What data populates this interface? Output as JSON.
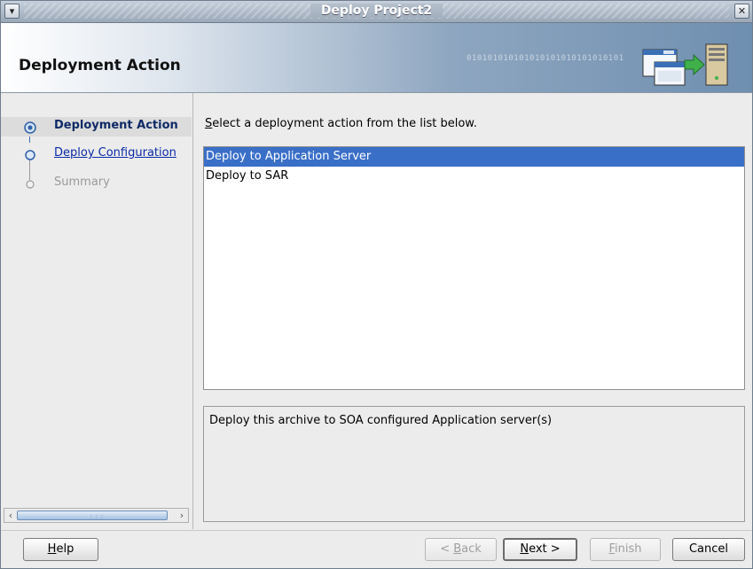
{
  "window": {
    "title": "Deploy Project2"
  },
  "banner": {
    "heading": "Deployment Action",
    "decor_text": "010101010101010101010101010101"
  },
  "nav": {
    "items": [
      {
        "label": "Deployment Action",
        "state": "active"
      },
      {
        "label": "Deploy Configuration",
        "state": "link"
      },
      {
        "label": "Summary",
        "state": "disabled"
      }
    ]
  },
  "main": {
    "instruction_prefix": "S",
    "instruction_rest": "elect a deployment action from the list below.",
    "actions": [
      {
        "label": "Deploy to Application Server",
        "selected": true
      },
      {
        "label": "Deploy to SAR",
        "selected": false
      }
    ],
    "description": "Deploy this archive to SOA configured Application server(s)"
  },
  "footer": {
    "help": {
      "mn": "H",
      "rest": "elp"
    },
    "back": {
      "pre": "< ",
      "mn": "B",
      "rest": "ack"
    },
    "next": {
      "mn": "N",
      "rest": "ext >"
    },
    "finish": {
      "mn": "F",
      "rest": "inish"
    },
    "cancel": "Cancel"
  },
  "colors": {
    "selection": "#3a6fc8",
    "link": "#0a2ba6",
    "active_nav": "#0f2a66"
  }
}
